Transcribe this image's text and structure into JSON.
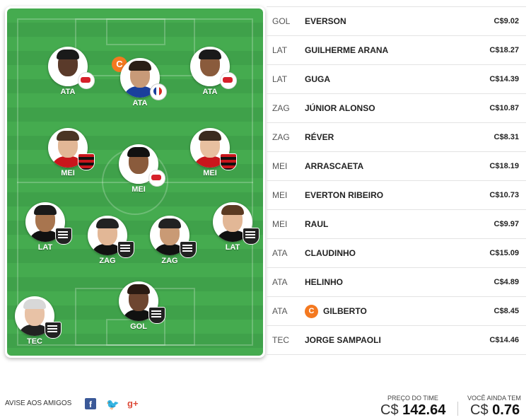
{
  "field": {
    "players": [
      {
        "pos_label": "ATA",
        "club": "rb",
        "skin": "#5a3a2a",
        "hair": "#1a1a1a",
        "shirt": "#ffffff"
      },
      {
        "pos_label": "ATA",
        "club": "bah",
        "skin": "#c89a78",
        "hair": "#2a1e16",
        "shirt": "#1a3f9c",
        "captain": "C"
      },
      {
        "pos_label": "ATA",
        "club": "rb",
        "skin": "#8a5b3c",
        "hair": "#1a1a1a",
        "shirt": "#ffffff"
      },
      {
        "pos_label": "MEI",
        "club": "fla",
        "skin": "#e2b796",
        "hair": "#4a3424",
        "shirt": "#c9161c"
      },
      {
        "pos_label": "MEI",
        "club": "rb",
        "skin": "#8a5b3c",
        "hair": "#111111",
        "shirt": "#ffffff"
      },
      {
        "pos_label": "MEI",
        "club": "fla",
        "skin": "#e8c0a0",
        "hair": "#3b2a1e",
        "shirt": "#c9161c"
      },
      {
        "pos_label": "LAT",
        "club": "cam",
        "skin": "#a8754f",
        "hair": "#1a1a1a",
        "shirt": "#111111"
      },
      {
        "pos_label": "ZAG",
        "club": "cam",
        "skin": "#e2b796",
        "hair": "#222222",
        "shirt": "#111111"
      },
      {
        "pos_label": "ZAG",
        "club": "cam",
        "skin": "#c99a75",
        "hair": "#222222",
        "shirt": "#111111"
      },
      {
        "pos_label": "LAT",
        "club": "cam",
        "skin": "#e2b796",
        "hair": "#5a3a22",
        "shirt": "#111111"
      },
      {
        "pos_label": "GOL",
        "club": "cam",
        "skin": "#6e4630",
        "hair": "#2a1a12",
        "shirt": "#111111"
      },
      {
        "pos_label": "TEC",
        "club": "cam",
        "skin": "#e8c2a6",
        "hair": "#d8d8d8",
        "shirt": "#222222"
      }
    ]
  },
  "lineup": [
    {
      "pos": "GOL",
      "name": "EVERSON",
      "price": "C$9.02"
    },
    {
      "pos": "LAT",
      "name": "GUILHERME ARANA",
      "price": "C$18.27"
    },
    {
      "pos": "LAT",
      "name": "GUGA",
      "price": "C$14.39"
    },
    {
      "pos": "ZAG",
      "name": "JÚNIOR ALONSO",
      "price": "C$10.87"
    },
    {
      "pos": "ZAG",
      "name": "RÉVER",
      "price": "C$8.31"
    },
    {
      "pos": "MEI",
      "name": "ARRASCAETA",
      "price": "C$18.19"
    },
    {
      "pos": "MEI",
      "name": "EVERTON RIBEIRO",
      "price": "C$10.73"
    },
    {
      "pos": "MEI",
      "name": "RAUL",
      "price": "C$9.97"
    },
    {
      "pos": "ATA",
      "name": "CLAUDINHO",
      "price": "C$15.09"
    },
    {
      "pos": "ATA",
      "name": "HELINHO",
      "price": "C$4.89"
    },
    {
      "pos": "ATA",
      "name": "GILBERTO",
      "price": "C$8.45",
      "captain": "C"
    },
    {
      "pos": "TEC",
      "name": "JORGE SAMPAOLI",
      "price": "C$14.46"
    }
  ],
  "footer": {
    "share_label": "AVISE AOS AMIGOS",
    "facebook_glyph": "f",
    "twitter_glyph": "🐦",
    "gplus_glyph": "g+",
    "team_price_label": "PREÇO DO TIME",
    "team_price_currency": "C$",
    "team_price_value": "142.64",
    "remaining_label": "VOCÊ AINDA TEM",
    "remaining_currency": "C$",
    "remaining_value": "0.76"
  },
  "colors": {
    "accent": "#f47920",
    "pitch": "#45ab4f"
  }
}
